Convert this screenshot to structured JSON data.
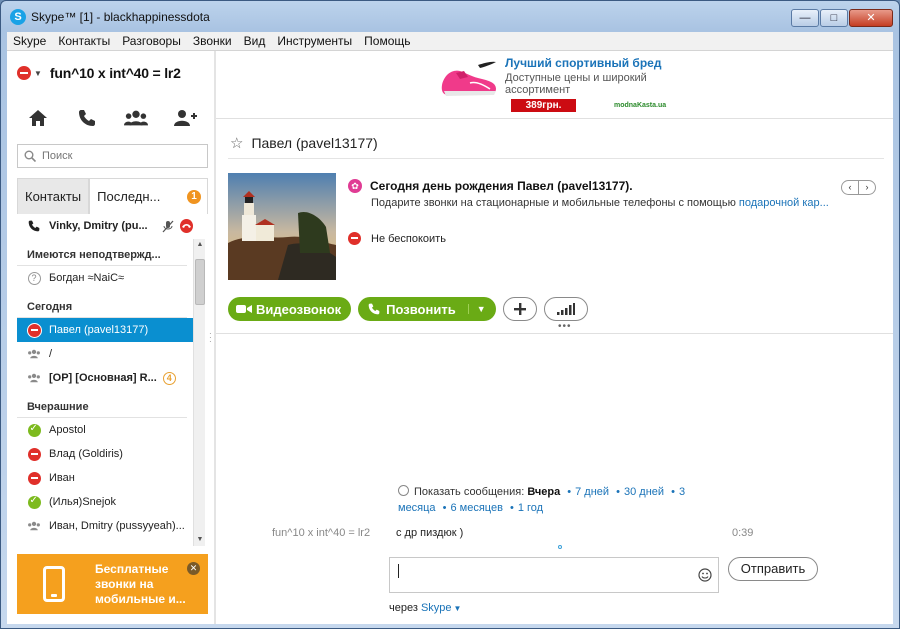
{
  "window": {
    "title": "Skype™ [1] - blackhappinessdota",
    "app_icon": "S",
    "buttons": {
      "minimize": "—",
      "maximize": "□",
      "close": "✕"
    }
  },
  "menu": [
    "Skype",
    "Контакты",
    "Разговоры",
    "Звонки",
    "Вид",
    "Инструменты",
    "Помощь"
  ],
  "profile": {
    "name": "fun^10 x int^40 = lr2",
    "status": "do-not-disturb"
  },
  "quick_icons": [
    "home-icon",
    "phone-icon",
    "group-icon",
    "add-contact-icon"
  ],
  "search": {
    "placeholder": "Поиск"
  },
  "tabs": {
    "contacts": "Контакты",
    "recent": "Последн...",
    "recent_badge": "1"
  },
  "contacts": {
    "active_call": {
      "name": "Vinky, Dmitry (pu..."
    },
    "groups": [
      {
        "title": "Имеются неподтвержд...",
        "items": [
          {
            "name": "Богдан ≈NaiC≈",
            "status": "pending"
          }
        ]
      },
      {
        "title": "Сегодня",
        "items": [
          {
            "name": "Павел (pavel13177)",
            "status": "dnd",
            "selected": true
          },
          {
            "name": "/",
            "status": "group"
          },
          {
            "name": "[OP] [Основная] R...",
            "status": "group",
            "bold": true,
            "badge": "4"
          }
        ]
      },
      {
        "title": "Вчерашние",
        "items": [
          {
            "name": "Apostol",
            "status": "online"
          },
          {
            "name": "Влад (Goldiris)",
            "status": "dnd"
          },
          {
            "name": "Иван",
            "status": "dnd"
          },
          {
            "name": "(Илья)Snejok",
            "status": "online"
          },
          {
            "name": "Иван, Dmitry (pussyyeah)...",
            "status": "group"
          }
        ]
      }
    ]
  },
  "promo": {
    "text": "Бесплатные звонки на мобильные и...",
    "close": "✕"
  },
  "ad": {
    "title": "Лучший спортивный бред",
    "desc": "Доступные цены и широкий ассортимент",
    "price": "389грн.",
    "site": "modnaKasta.ua"
  },
  "conversation": {
    "title": "Павел (pavel13177)",
    "birthday_title": "Сегодня день рождения Павел (pavel13177).",
    "birthday_text": "Подарите звонки на стационарные и мобильные телефоны с помощью ",
    "birthday_link": "подарочной кар...",
    "mood": "Не беспокоить",
    "pager_prev": "‹",
    "pager_next": "›",
    "video_call": "Видеозвонок",
    "call": "Позвонить",
    "history_label": "Показать сообщения:",
    "history_current": "Вчера",
    "history_options": [
      "7 дней",
      "30 дней",
      "3 месяца",
      "6 месяцев",
      "1 год"
    ],
    "message": {
      "author": "fun^10 x int^40 = lr2",
      "text": "с др пиздюк )",
      "time": "0:39"
    },
    "send": "Отправить",
    "via_label": "через",
    "via_link": "Skype"
  },
  "colors": {
    "accent_blue": "#0a8fd0",
    "green": "#6aab15",
    "dnd_red": "#e0302a",
    "promo_orange": "#f5a01e"
  }
}
